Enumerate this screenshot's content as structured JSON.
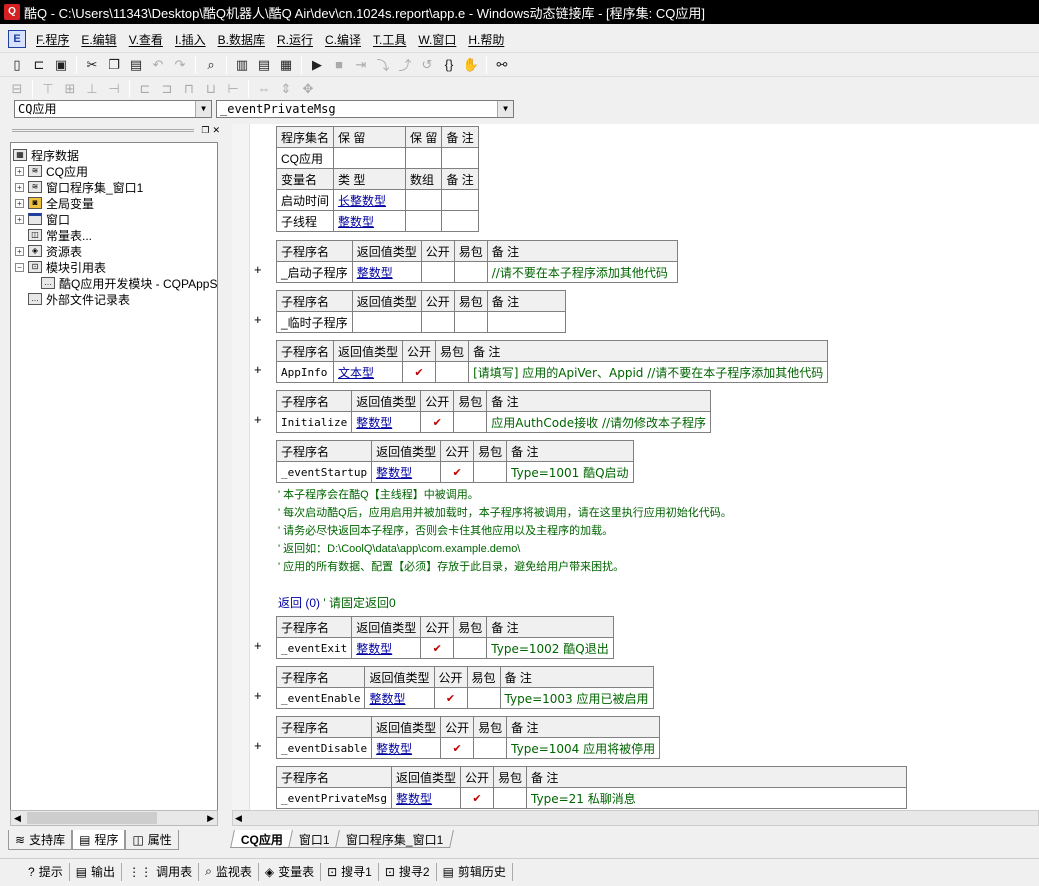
{
  "window": {
    "title": "酷Q - C:\\Users\\11343\\Desktop\\酷Q机器人\\酷Q Air\\dev\\cn.1024s.report\\app.e - Windows动态链接库 - [程序集: CQ应用]"
  },
  "menu": [
    "F.程序",
    "E.编辑",
    "V.查看",
    "I.插入",
    "B.数据库",
    "R.运行",
    "C.编译",
    "T.工具",
    "W.窗口",
    "H.帮助"
  ],
  "combos": {
    "left": "CQ应用",
    "right": "_eventPrivateMsg"
  },
  "tree": {
    "root": "程序数据",
    "items": [
      "CQ应用",
      "窗口程序集_窗口1",
      "全局变量",
      "窗口",
      "常量表...",
      "资源表",
      "模块引用表",
      "酷Q应用开发模块 - CQPAppS",
      "外部文件记录表"
    ]
  },
  "left_tabs": [
    "支持库",
    "程序",
    "属性"
  ],
  "editor_tabs": [
    "CQ应用",
    "窗口1",
    "窗口程序集_窗口1"
  ],
  "status_buttons": [
    "提示",
    "输出",
    "调用表",
    "监视表",
    "变量表",
    "搜寻1",
    "搜寻2",
    "剪辑历史"
  ],
  "code": {
    "assembly": {
      "h1": [
        "程序集名",
        "保 留",
        "保 留",
        "备 注"
      ],
      "name": "CQ应用",
      "h2": [
        "变量名",
        "类 型",
        "数组",
        "备 注"
      ],
      "vars": [
        {
          "name": "启动时间",
          "type": "长整数型"
        },
        {
          "name": "子线程",
          "type": "整数型"
        }
      ]
    },
    "sub_header": [
      "子程序名",
      "返回值类型",
      "公开",
      "易包",
      "备 注"
    ],
    "subs": [
      {
        "name": "_启动子程序",
        "type": "整数型",
        "public": "",
        "comment": "//请不要在本子程序添加其他代码"
      },
      {
        "name": "_临时子程序",
        "type": "",
        "public": "",
        "comment": ""
      },
      {
        "name": "AppInfo",
        "type": "文本型",
        "public": "✔",
        "comment": "[请填写] 应用的ApiVer、Appid //请不要在本子程序添加其他代码"
      },
      {
        "name": "Initialize",
        "type": "整数型",
        "public": "✔",
        "comment": "应用AuthCode接收 //请勿修改本子程序"
      },
      {
        "name": "_eventStartup",
        "type": "整数型",
        "public": "✔",
        "comment": "Type=1001 酷Q启动"
      },
      {
        "name": "_eventExit",
        "type": "整数型",
        "public": "✔",
        "comment": "Type=1002 酷Q退出"
      },
      {
        "name": "_eventEnable",
        "type": "整数型",
        "public": "✔",
        "comment": "Type=1003 应用已被启用"
      },
      {
        "name": "_eventDisable",
        "type": "整数型",
        "public": "✔",
        "comment": "Type=1004 应用将被停用"
      },
      {
        "name": "_eventPrivateMsg",
        "type": "整数型",
        "public": "✔",
        "comment": "Type=21 私聊消息"
      }
    ],
    "comments": [
      "' 本子程序会在酷Q【主线程】中被调用。",
      "' 每次启动酷Q后，应用启用并被加载时，本子程序将被调用，请在这里执行应用初始化代码。",
      "' 请务必尽快返回本子程序，否则会卡住其他应用以及主程序的加载。",
      "' 返回如：D:\\CoolQ\\data\\app\\com.example.demo\\",
      "' 应用的所有数据、配置【必须】存放于此目录，避免给用户带来困扰。"
    ],
    "return_kw": "返回 (0)",
    "return_comment": "' 请固定返回0"
  }
}
